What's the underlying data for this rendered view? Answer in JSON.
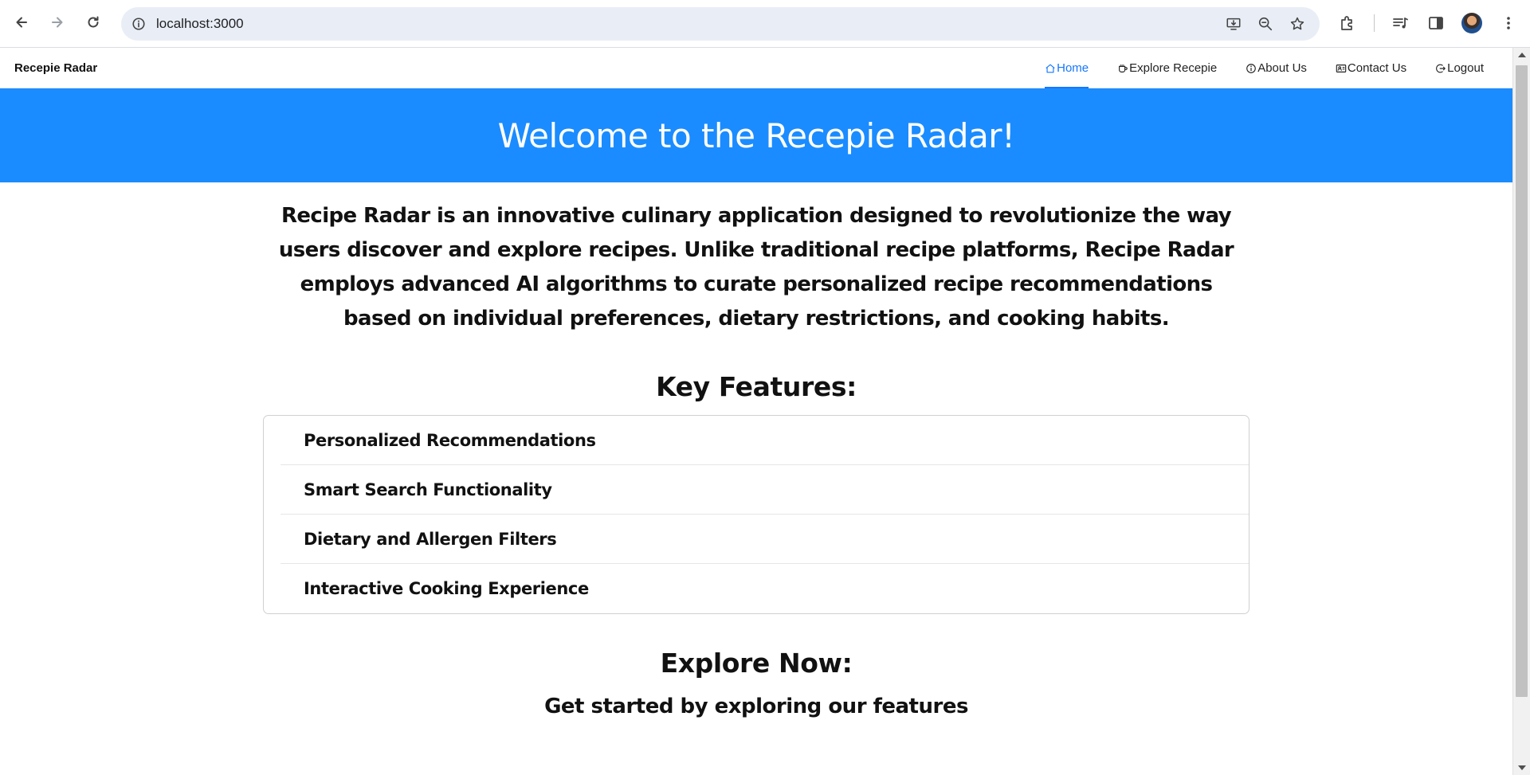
{
  "browser": {
    "url": "localhost:3000",
    "icons": [
      "back-arrow-icon",
      "forward-arrow-icon",
      "reload-icon",
      "site-info-icon",
      "install-app-icon",
      "zoom-icon",
      "bookmark-star-icon",
      "extensions-icon",
      "media-control-icon",
      "side-panel-icon",
      "profile-avatar",
      "more-menu-icon"
    ]
  },
  "navbar": {
    "brand": "Recepie Radar",
    "links": [
      {
        "label": "Home",
        "icon": "home-icon",
        "active": true
      },
      {
        "label": "Explore Recepie",
        "icon": "cup-icon",
        "active": false
      },
      {
        "label": "About Us",
        "icon": "info-icon",
        "active": false
      },
      {
        "label": "Contact Us",
        "icon": "contact-card-icon",
        "active": false
      },
      {
        "label": "Logout",
        "icon": "logout-icon",
        "active": false
      }
    ],
    "accent_color": "#1677ff"
  },
  "hero": {
    "title": "Welcome to the Recepie Radar!",
    "background": "#1a8cff"
  },
  "main": {
    "intro": "Recipe Radar is an innovative culinary application designed to revolutionize the way users discover and explore recipes. Unlike traditional recipe platforms, Recipe Radar employs advanced AI algorithms to curate personalized recipe recommendations based on individual preferences, dietary restrictions, and cooking habits.",
    "key_features_title": "Key Features:",
    "features": [
      "Personalized Recommendations",
      "Smart Search Functionality",
      "Dietary and Allergen Filters",
      "Interactive Cooking Experience"
    ],
    "explore_title": "Explore Now:",
    "explore_subtitle": "Get started by exploring our features"
  }
}
